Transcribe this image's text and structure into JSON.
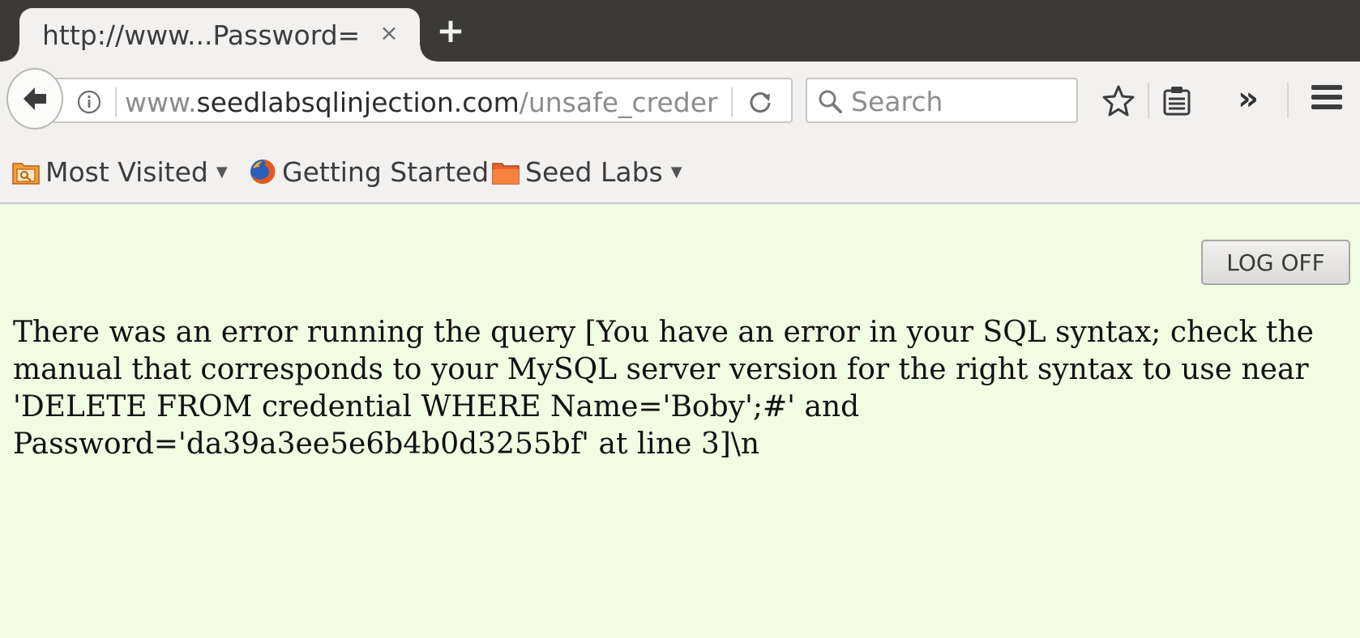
{
  "browser": {
    "tab": {
      "title": "http://www...Password=",
      "close_glyph": "×"
    },
    "new_tab_glyph": "+",
    "url": {
      "prefix": "www.",
      "host": "seedlabsqlinjection.com",
      "path": "/unsafe_creder"
    },
    "search": {
      "placeholder": "Search"
    },
    "overflow_glyph": "»",
    "icons": [
      "back-arrow-icon",
      "info-icon",
      "reload-icon",
      "search-icon",
      "star-bookmark-icon",
      "reading-list-icon",
      "hamburger-menu-icon"
    ]
  },
  "bookmarks": [
    {
      "label": "Most Visited",
      "icon": "smart-folder-icon",
      "has_dropdown": true
    },
    {
      "label": "Getting Started",
      "icon": "firefox-icon",
      "has_dropdown": false
    },
    {
      "label": "Seed Labs",
      "icon": "folder-icon",
      "has_dropdown": true
    }
  ],
  "page": {
    "logoff_label": "LOG OFF",
    "error_message": "There was an error running the query [You have an error in your SQL syntax; check the manual that corresponds to your MySQL server version for the right syntax to use near 'DELETE FROM credential WHERE Name='Boby';#' and Password='da39a3ee5e6b4b0d3255bf' at line 3]\\n",
    "background_color": "#f0fde2"
  }
}
